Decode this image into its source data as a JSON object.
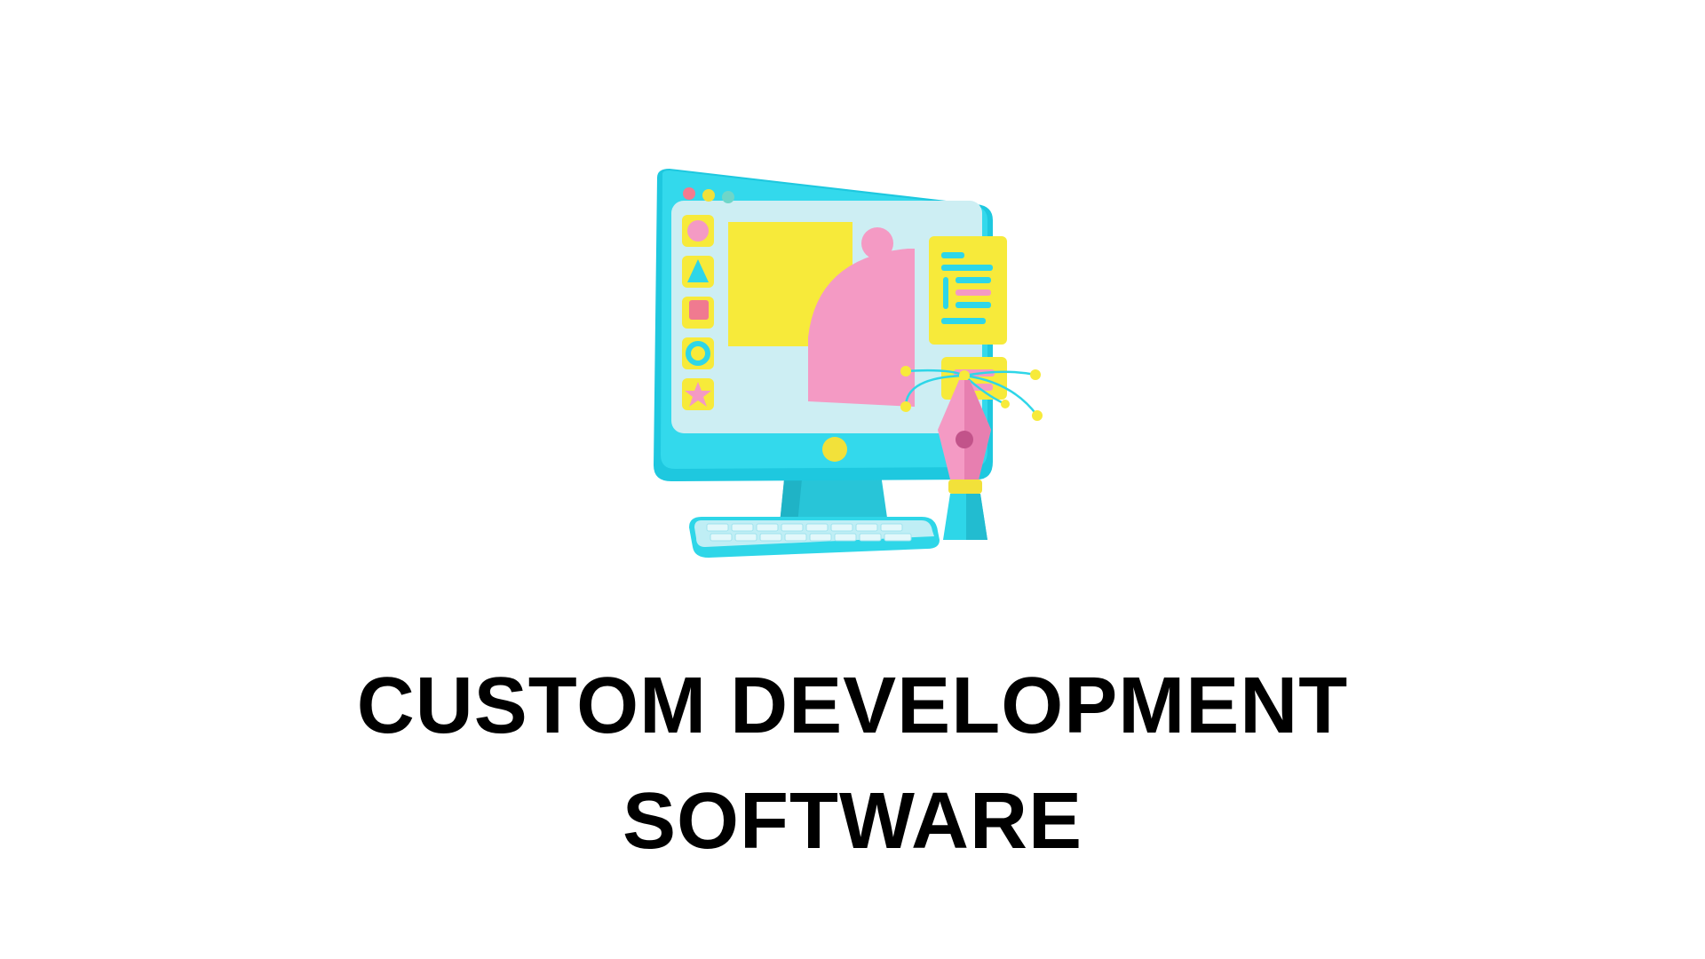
{
  "headline": {
    "line1": "CUSTOM DEVELOPMENT",
    "line2": "SOFTWARE"
  },
  "illustration": {
    "icon": "computer-with-pen-tool-icon",
    "colors": {
      "monitor": "#2ed6e8",
      "screen": "#cdeef3",
      "yellow": "#f7ea3a",
      "pink": "#f49ac4",
      "keyboard": "#bfeef5"
    }
  }
}
